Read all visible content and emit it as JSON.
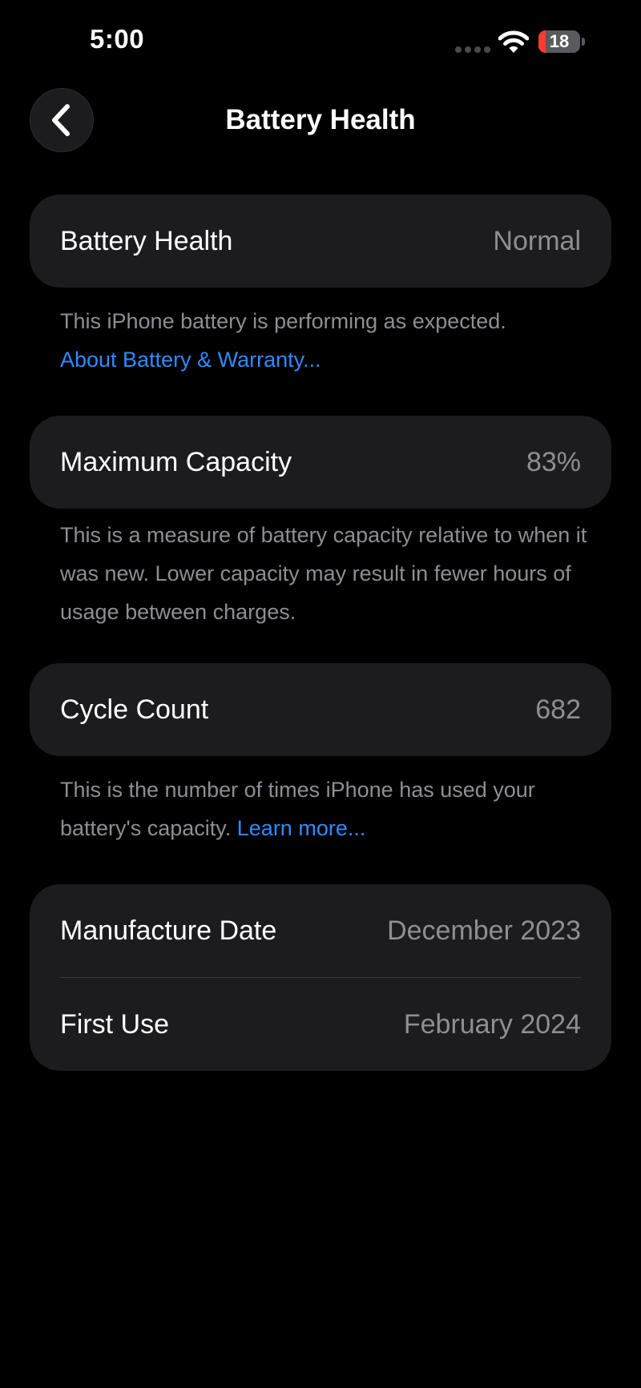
{
  "status_bar": {
    "time": "5:00",
    "battery_level": "18",
    "battery_fraction": 0.18,
    "icons": [
      "signal-dots",
      "wifi-icon",
      "battery-icon"
    ]
  },
  "nav": {
    "title": "Battery Health",
    "back_icon": "chevron-left-icon"
  },
  "battery_health": {
    "label": "Battery Health",
    "value": "Normal",
    "description": "This iPhone battery is performing as expected.",
    "link": "About Battery & Warranty..."
  },
  "maximum_capacity": {
    "label": "Maximum Capacity",
    "value": "83%",
    "description": "This is a measure of battery capacity relative to when it was new. Lower capacity may result in fewer hours of usage between charges."
  },
  "cycle_count": {
    "label": "Cycle Count",
    "value": "682",
    "description": "This is the number of times iPhone has used your battery's capacity.",
    "link": "Learn more..."
  },
  "dates": {
    "manufacture_label": "Manufacture Date",
    "manufacture_value": "December 2023",
    "first_use_label": "First Use",
    "first_use_value": "February 2024"
  },
  "colors": {
    "background": "#000000",
    "card": "#1c1c1e",
    "secondary_text": "#8e8e93",
    "link": "#2f8bff",
    "battery_low": "#ff3b30"
  }
}
